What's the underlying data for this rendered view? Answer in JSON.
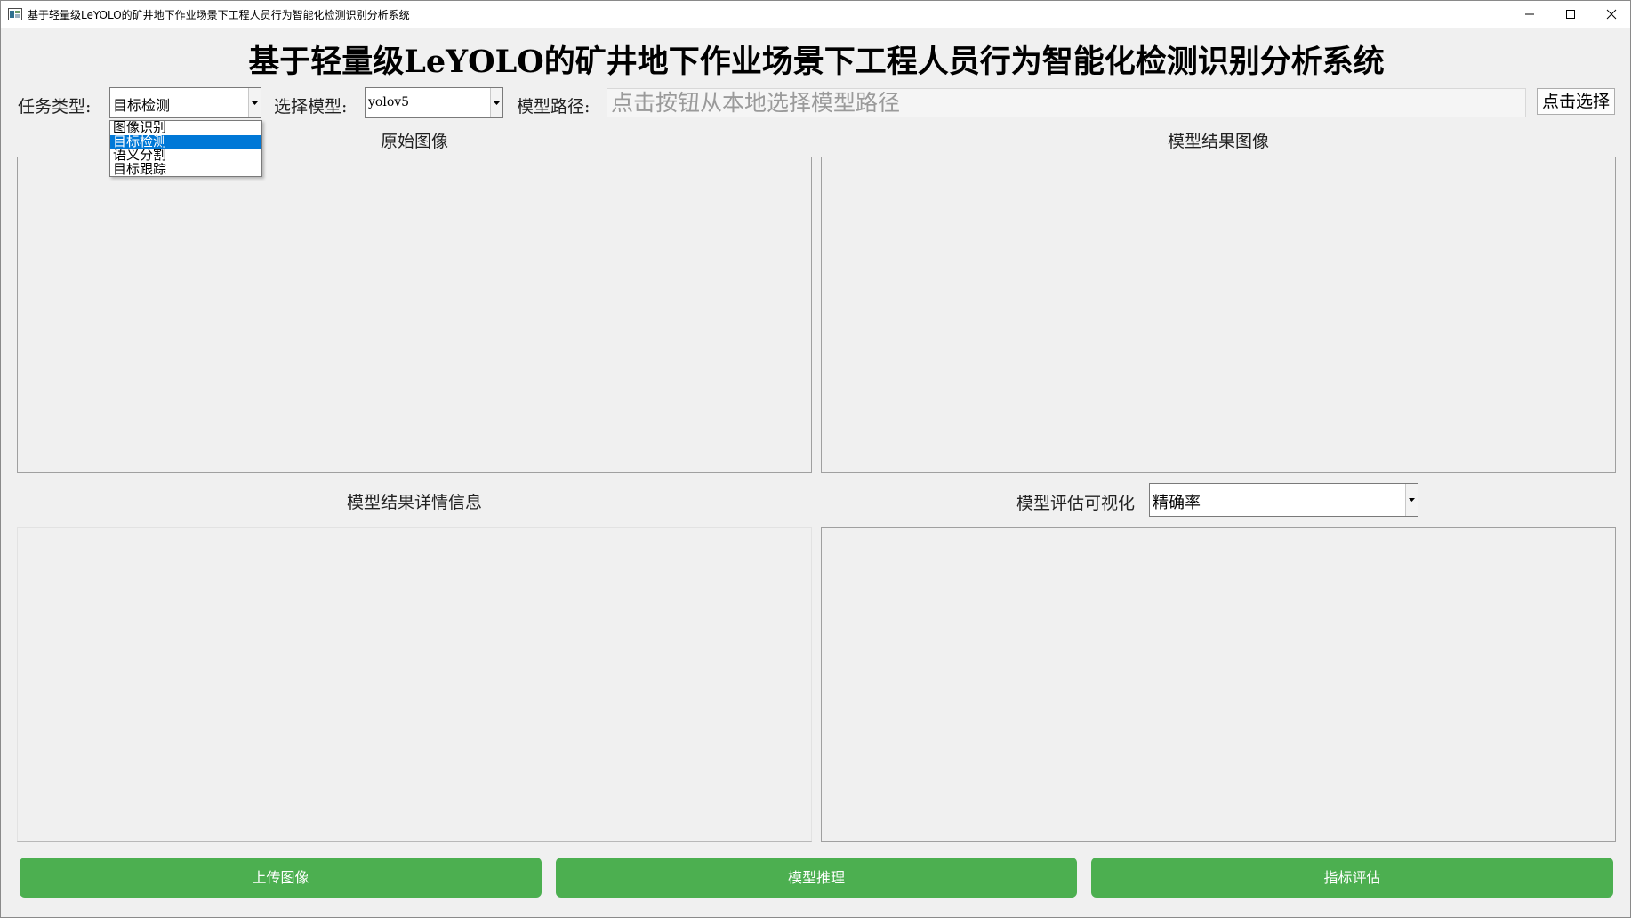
{
  "window": {
    "title": "基于轻量级LeYOLO的矿井地下作业场景下工程人员行为智能化检测识别分析系统"
  },
  "header": {
    "heading": "基于轻量级LeYOLO的矿井地下作业场景下工程人员行为智能化检测识别分析系统"
  },
  "toolbar": {
    "task_label": "任务类型:",
    "task_value": "目标检测",
    "task_options": [
      "图像识别",
      "目标检测",
      "语义分割",
      "目标跟踪"
    ],
    "model_label": "选择模型:",
    "model_value": "yolov5",
    "path_label": "模型路径:",
    "path_placeholder": "点击按钮从本地选择模型路径",
    "choose_button": "点击选择"
  },
  "panels": {
    "original_label": "原始图像",
    "result_label": "模型结果图像",
    "details_label": "模型结果详情信息",
    "eval_label": "模型评估可视化",
    "eval_metric_value": "精确率"
  },
  "actions": {
    "upload": "上传图像",
    "infer": "模型推理",
    "evaluate": "指标评估"
  },
  "colors": {
    "button_green": "#4caf50",
    "selection_blue": "#0078d7"
  }
}
